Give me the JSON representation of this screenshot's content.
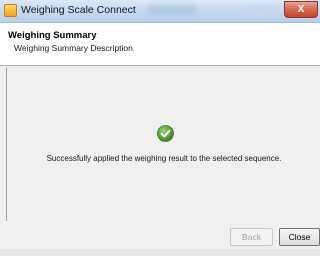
{
  "window": {
    "title": "Weighing Scale Connect",
    "close_glyph": "X"
  },
  "header": {
    "title": "Weighing Summary",
    "description": "Weighing Summary Description"
  },
  "content": {
    "status_icon": "success-check-icon",
    "message": "Successfully applied the weighing result to the selected sequence."
  },
  "footer": {
    "back_label": "Back",
    "close_label": "Close"
  },
  "colors": {
    "success": "#5aa63c",
    "titlebar": "#c6d9f0",
    "close_button": "#c2462e"
  }
}
